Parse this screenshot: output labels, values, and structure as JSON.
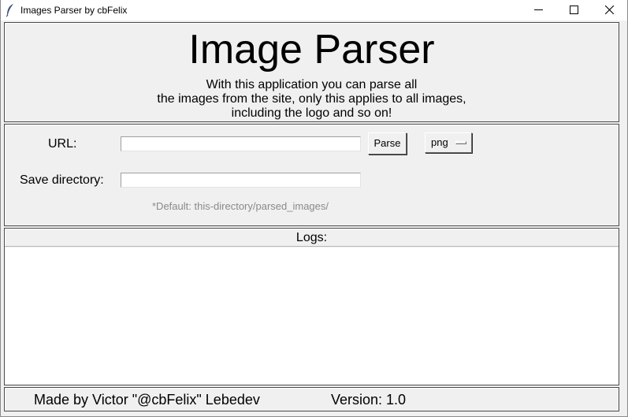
{
  "window": {
    "title": "Images Parser by cbFelix",
    "icon": "feather-icon",
    "controls": [
      "minimize-icon",
      "maximize-icon",
      "close-icon"
    ]
  },
  "header": {
    "title": "Image Parser",
    "description_lines": [
      "With this application you can parse all",
      "the images from the site, only this applies to all images,",
      "including the logo and so on!"
    ]
  },
  "form": {
    "url_label": "URL:",
    "url_value": "",
    "parse_button": "Parse",
    "format_selected": "png",
    "save_dir_label": "Save directory:",
    "save_dir_value": "",
    "default_hint": "*Default: this-directory/parsed_images/"
  },
  "logs": {
    "header": "Logs:",
    "content": ""
  },
  "footer": {
    "credit": "Made by Victor \"@cbFelix\" Lebedev",
    "version": "Version: 1.0"
  }
}
